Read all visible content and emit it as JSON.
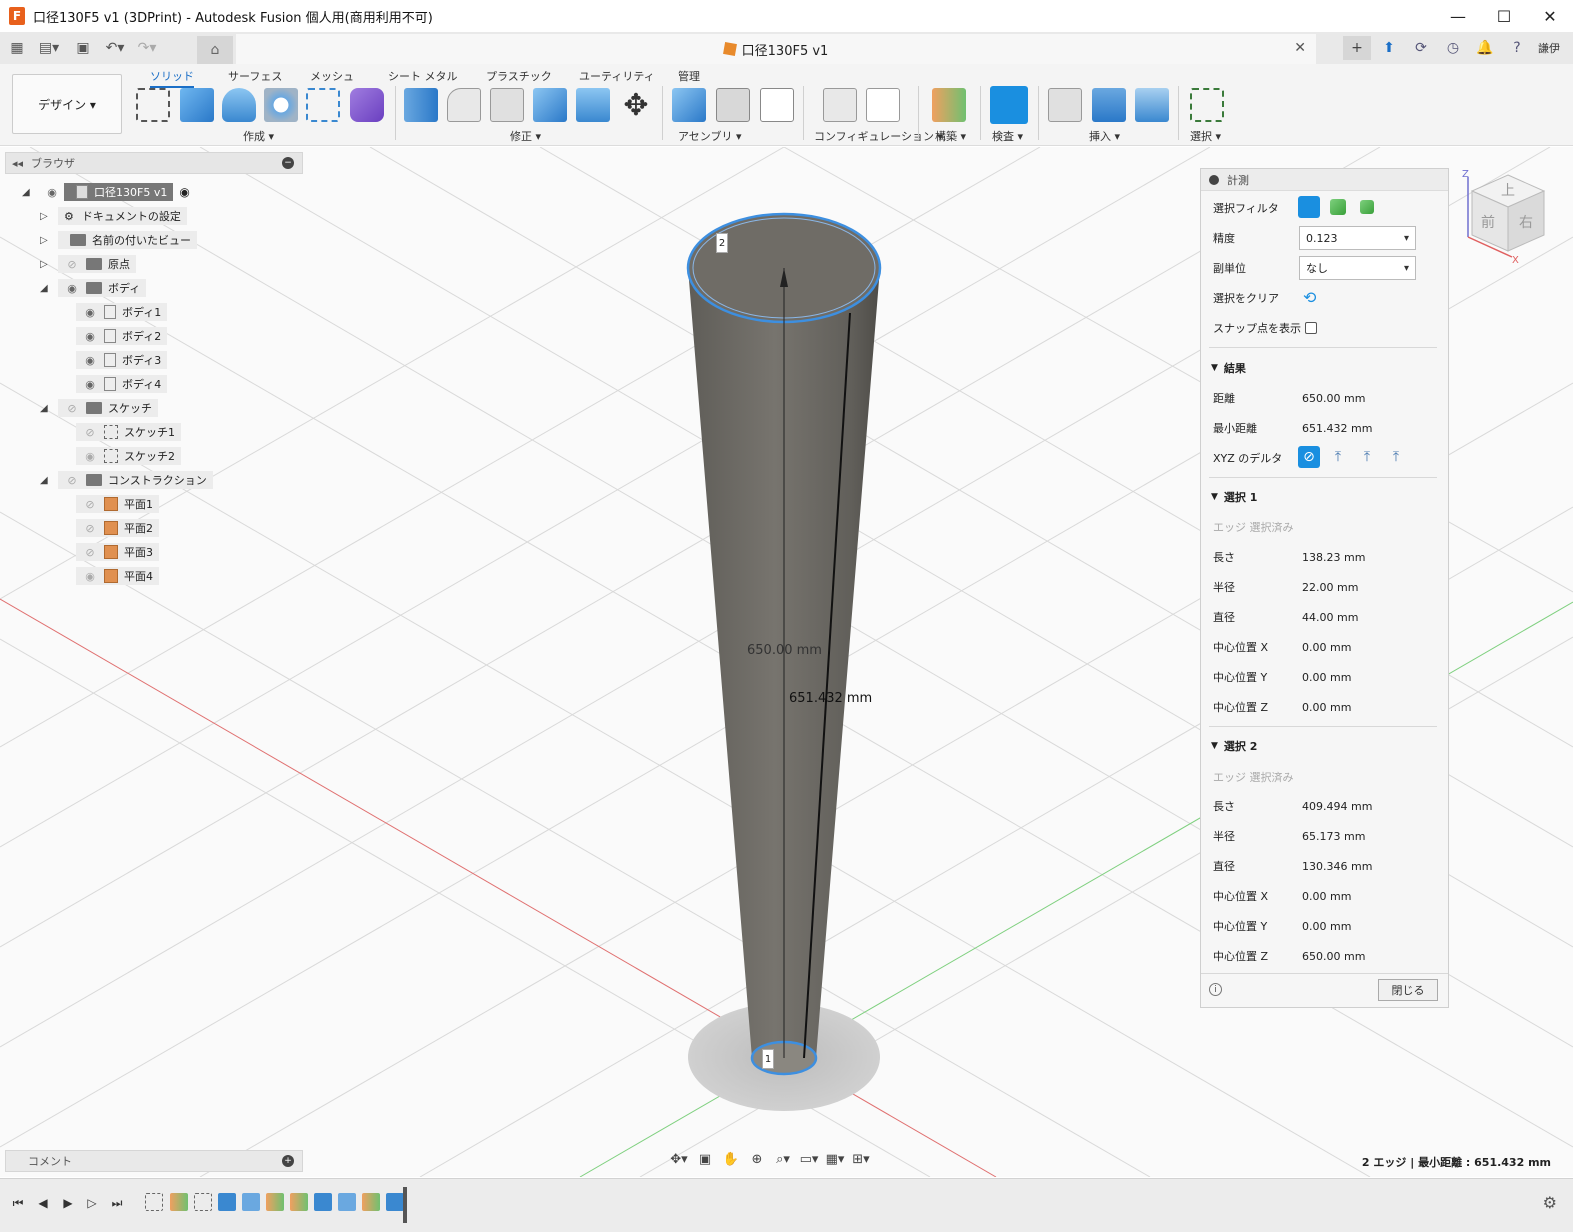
{
  "window": {
    "title": "口径130F5 v1 (3DPrint) - Autodesk Fusion 個人用(商用利用不可)",
    "app_icon": "F",
    "controls": [
      "—",
      "☐",
      "✕"
    ]
  },
  "tabs": {
    "document_tab": "口径130F5 v1",
    "user": "謙伊"
  },
  "ribbon": {
    "workspace": "デザイン ▾",
    "tabs": [
      "ソリッド",
      "サーフェス",
      "メッシュ",
      "シート メタル",
      "プラスチック",
      "ユーティリティ",
      "管理"
    ],
    "groups": [
      "作成 ▾",
      "修正 ▾",
      "アセンブリ ▾",
      "コンフィギュレーション ▾",
      "構築 ▾",
      "検査 ▾",
      "挿入 ▾",
      "選択 ▾"
    ]
  },
  "browser": {
    "header": "ブラウザ",
    "root": "口径130F5 v1",
    "items": {
      "doc_settings": "ドキュメントの設定",
      "named_views": "名前の付いたビュー",
      "origin": "原点",
      "bodies": "ボディ",
      "body1": "ボディ1",
      "body2": "ボディ2",
      "body3": "ボディ3",
      "body4": "ボディ4",
      "sketches": "スケッチ",
      "sketch1": "スケッチ1",
      "sketch2": "スケッチ2",
      "construction": "コンストラクション",
      "plane1": "平面1",
      "plane2": "平面2",
      "plane3": "平面3",
      "plane4": "平面4"
    }
  },
  "comments": {
    "label": "コメント"
  },
  "viewport": {
    "dim_distance": "650.00 mm",
    "dim_min_distance": "651.432 mm",
    "marker_top": "2",
    "marker_bottom": "1"
  },
  "viewcube": {
    "top": "上",
    "front": "前",
    "right": "右",
    "axis_x": "X",
    "axis_z": "Z"
  },
  "measure": {
    "title": "計測",
    "filter_label": "選択フィルタ",
    "precision_label": "精度",
    "precision_value": "0.123",
    "subunit_label": "副単位",
    "subunit_value": "なし",
    "clear_label": "選択をクリア",
    "snap_label": "スナップ点を表示",
    "results_title": "結果",
    "distance_label": "距離",
    "distance_value": "650.00 mm",
    "min_distance_label": "最小距離",
    "min_distance_value": "651.432 mm",
    "xyz_label": "XYZ のデルタ",
    "sel1": {
      "title": "選択 1",
      "status": "エッジ 選択済み",
      "length_label": "長さ",
      "length": "138.23 mm",
      "radius_label": "半径",
      "radius": "22.00 mm",
      "diameter_label": "直径",
      "diameter": "44.00 mm",
      "cx_label": "中心位置 X",
      "cx": "0.00 mm",
      "cy_label": "中心位置 Y",
      "cy": "0.00 mm",
      "cz_label": "中心位置 Z",
      "cz": "0.00 mm"
    },
    "sel2": {
      "title": "選択 2",
      "status": "エッジ 選択済み",
      "length_label": "長さ",
      "length": "409.494 mm",
      "radius_label": "半径",
      "radius": "65.173 mm",
      "diameter_label": "直径",
      "diameter": "130.346 mm",
      "cx_label": "中心位置 X",
      "cx": "0.00 mm",
      "cy_label": "中心位置 Y",
      "cy": "0.00 mm",
      "cz_label": "中心位置 Z",
      "cz": "650.00 mm"
    },
    "close_label": "閉じる"
  },
  "status": {
    "left": "2 エッジ | 最小距離 : ",
    "right": "651.432 mm"
  },
  "colors": {
    "accent": "#1b6fc7",
    "cone": "#6e6c66",
    "selection": "#3d8fe0",
    "plane_icon": "#e09050"
  }
}
